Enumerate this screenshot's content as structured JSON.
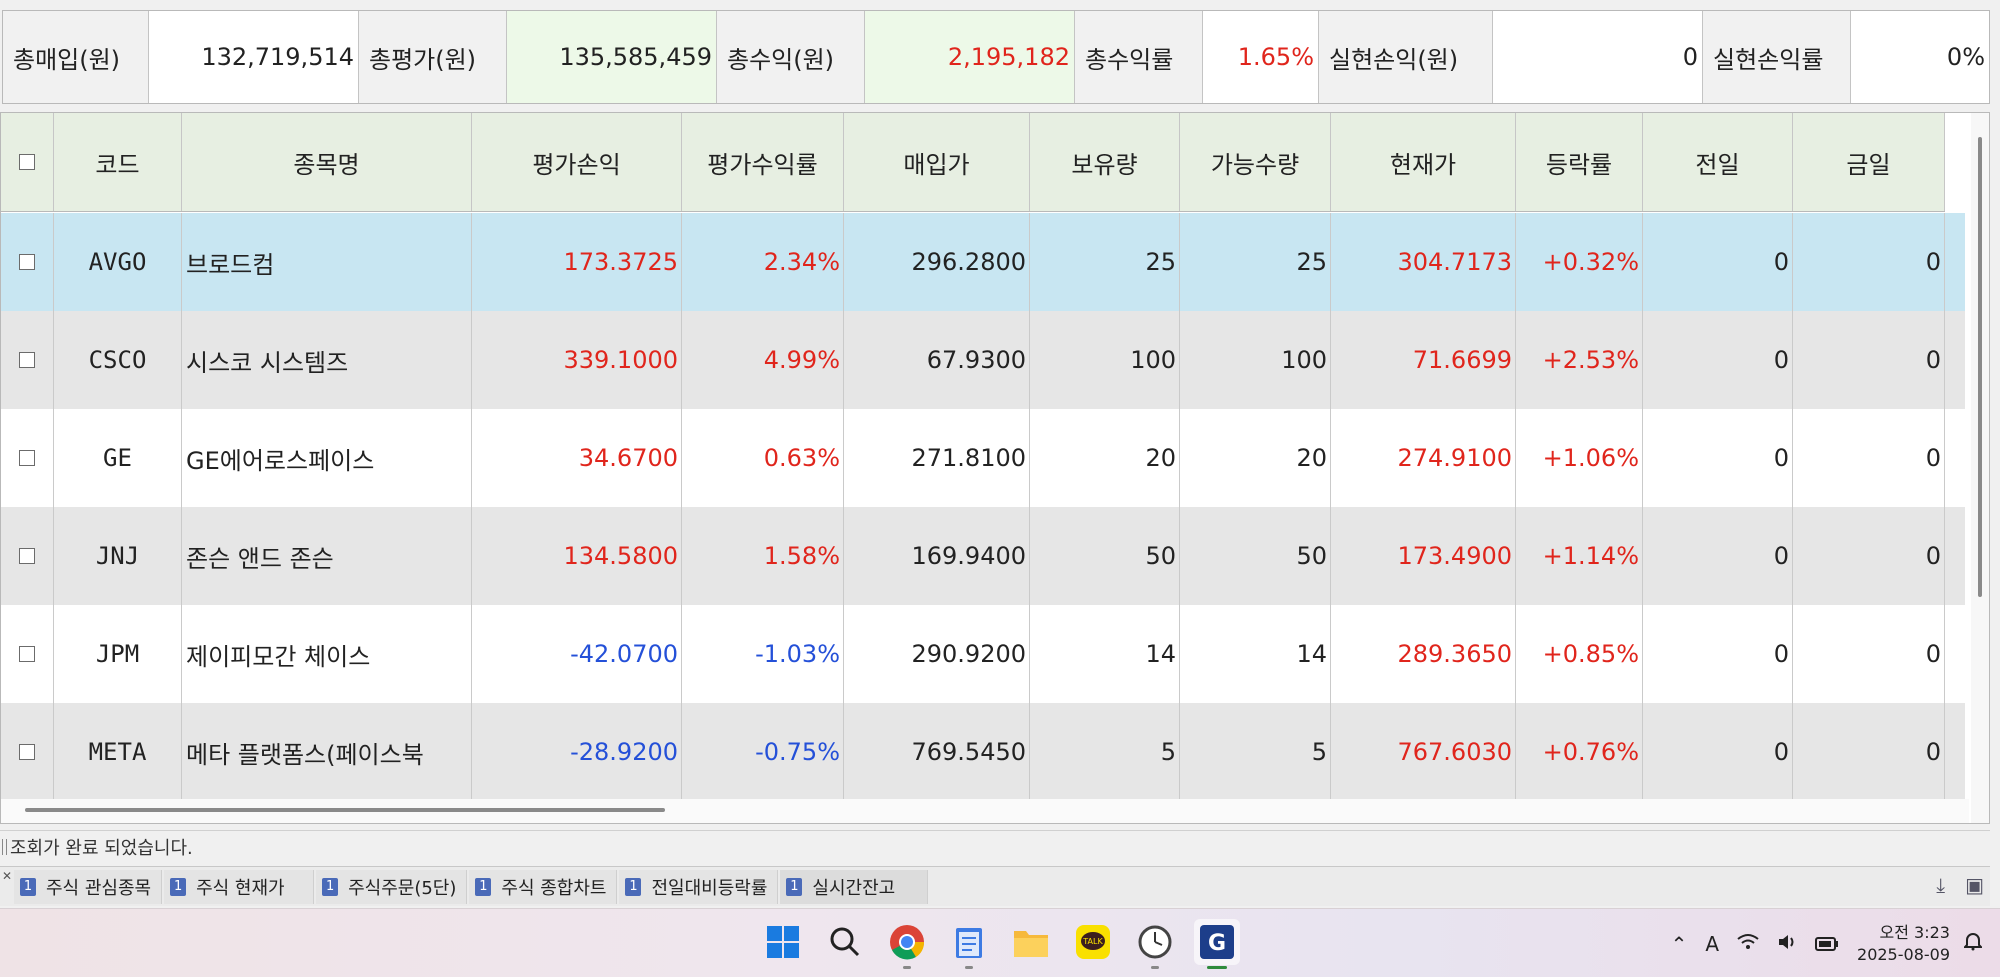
{
  "summary": {
    "total_buy_label": "총매입(원)",
    "total_buy_value": "132,719,514",
    "total_eval_label": "총평가(원)",
    "total_eval_value": "135,585,459",
    "total_profit_label": "총수익(원)",
    "total_profit_value": "2,195,182",
    "total_rate_label": "총수익률",
    "total_rate_value": "1.65%",
    "realized_label": "실현손익(원)",
    "realized_value": "0",
    "realized_rate_label": "실현손익률",
    "realized_rate_value": "0%"
  },
  "grid": {
    "columns": [
      "코드",
      "종목명",
      "평가손익",
      "평가수익률",
      "매입가",
      "보유량",
      "가능수량",
      "현재가",
      "등락률",
      "전일",
      "금일"
    ],
    "rows": [
      {
        "code": "AVGO",
        "name": "브로드컴",
        "eval_pl": "173.3725",
        "eval_rate": "2.34%",
        "buy_price": "296.2800",
        "qty": "25",
        "avail": "25",
        "price": "304.7173",
        "change": "+0.32%",
        "prev": "0",
        "today": "0",
        "pl_color": "red"
      },
      {
        "code": "CSCO",
        "name": "시스코 시스템즈",
        "eval_pl": "339.1000",
        "eval_rate": "4.99%",
        "buy_price": "67.9300",
        "qty": "100",
        "avail": "100",
        "price": "71.6699",
        "change": "+2.53%",
        "prev": "0",
        "today": "0",
        "pl_color": "red"
      },
      {
        "code": "GE",
        "name": "GE에어로스페이스",
        "eval_pl": "34.6700",
        "eval_rate": "0.63%",
        "buy_price": "271.8100",
        "qty": "20",
        "avail": "20",
        "price": "274.9100",
        "change": "+1.06%",
        "prev": "0",
        "today": "0",
        "pl_color": "red"
      },
      {
        "code": "JNJ",
        "name": "존슨 앤드 존슨",
        "eval_pl": "134.5800",
        "eval_rate": "1.58%",
        "buy_price": "169.9400",
        "qty": "50",
        "avail": "50",
        "price": "173.4900",
        "change": "+1.14%",
        "prev": "0",
        "today": "0",
        "pl_color": "red"
      },
      {
        "code": "JPM",
        "name": "제이피모간 체이스",
        "eval_pl": "-42.0700",
        "eval_rate": "-1.03%",
        "buy_price": "290.9200",
        "qty": "14",
        "avail": "14",
        "price": "289.3650",
        "change": "+0.85%",
        "prev": "0",
        "today": "0",
        "pl_color": "blue"
      },
      {
        "code": "META",
        "name": "메타 플랫폼스(페이스북",
        "eval_pl": "-28.9200",
        "eval_rate": "-0.75%",
        "buy_price": "769.5450",
        "qty": "5",
        "avail": "5",
        "price": "767.6030",
        "change": "+0.76%",
        "prev": "0",
        "today": "0",
        "pl_color": "blue"
      }
    ]
  },
  "status_text": "조회가 완료 되었습니다.",
  "tabs": [
    {
      "num": "1",
      "label": "주식 관심종목"
    },
    {
      "num": "1",
      "label": "주식 현재가"
    },
    {
      "num": "1",
      "label": "주식주문(5단)"
    },
    {
      "num": "1",
      "label": "주식 종합차트"
    },
    {
      "num": "1",
      "label": "전일대비등락률"
    },
    {
      "num": "1",
      "label": "실시간잔고"
    }
  ],
  "taskbar": {
    "time": "오전 3:23",
    "date": "2025-08-09",
    "ime": "A",
    "icons": [
      "windows-start-icon",
      "search-icon",
      "chrome-icon",
      "notepad-icon",
      "file-explorer-icon",
      "kakaotalk-icon",
      "clock-app-icon",
      "trading-app-icon"
    ]
  },
  "colors": {
    "red": "#e0251c",
    "blue": "#2450d8",
    "header_bg": "#e7efe2",
    "selected_row": "#c8e6f2"
  }
}
